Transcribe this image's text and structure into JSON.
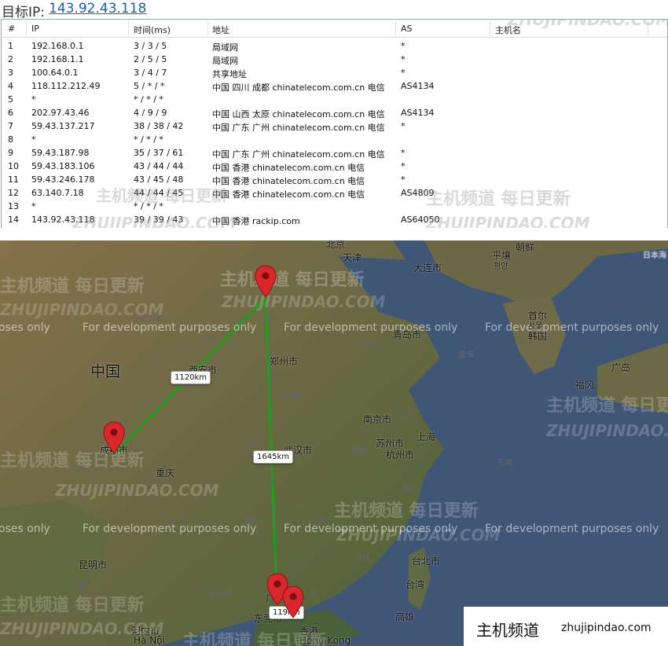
{
  "header": {
    "label": "目标IP:",
    "ip": "143.92.43.118"
  },
  "table": {
    "columns": [
      "#",
      "IP",
      "时间(ms)",
      "地址",
      "AS",
      "主机名"
    ],
    "rows": [
      {
        "n": "1",
        "ip": "192.168.0.1",
        "time": "3 / 3 / 5",
        "addr": "局域网",
        "as": "*"
      },
      {
        "n": "2",
        "ip": "192.168.1.1",
        "time": "2 / 5 / 5",
        "addr": "局域网",
        "as": "*"
      },
      {
        "n": "3",
        "ip": "100.64.0.1",
        "time": "3 / 4 / 7",
        "addr": "共享地址",
        "as": "*"
      },
      {
        "n": "4",
        "ip": "118.112.212.49",
        "time": "5 / * / *",
        "addr": "中国 四川 成都 chinatelecom.com.cn 电信",
        "as": "AS4134"
      },
      {
        "n": "5",
        "ip": "*",
        "time": "* / * / *",
        "addr": "",
        "as": ""
      },
      {
        "n": "6",
        "ip": "202.97.43.46",
        "time": "4 / 9 / 9",
        "addr": "中国 山西 太原 chinatelecom.com.cn 电信",
        "as": "AS4134"
      },
      {
        "n": "7",
        "ip": "59.43.137.217",
        "time": "38 / 38 / 42",
        "addr": "中国 广东 广州 chinatelecom.com.cn 电信",
        "as": "*"
      },
      {
        "n": "8",
        "ip": "*",
        "time": "* / * / *",
        "addr": "",
        "as": ""
      },
      {
        "n": "9",
        "ip": "59.43.187.98",
        "time": "35 / 37 / 61",
        "addr": "中国 广东 广州 chinatelecom.com.cn 电信",
        "as": "*"
      },
      {
        "n": "10",
        "ip": "59.43.183.106",
        "time": "43 / 44 / 44",
        "addr": "中国 香港 chinatelecom.com.cn 电信",
        "as": "*"
      },
      {
        "n": "11",
        "ip": "59.43.246.178",
        "time": "43 / 45 / 48",
        "addr": "中国 香港 chinatelecom.com.cn 电信",
        "as": "*"
      },
      {
        "n": "12",
        "ip": "63.140.7.18",
        "time": "44 / 44 / 45",
        "addr": "中国 香港 chinatelecom.com.cn 电信",
        "as": "AS4809"
      },
      {
        "n": "13",
        "ip": "*",
        "time": "* / * / *",
        "addr": "",
        "as": ""
      },
      {
        "n": "14",
        "ip": "143.92.43.118",
        "time": "39 / 39 / 43",
        "addr": "中国 香港 rackip.com",
        "as": "AS64050"
      }
    ]
  },
  "map": {
    "dev_text": "For development purposes only",
    "dev_text_left": "oses only",
    "cities": {
      "beijing": "北京",
      "tianjin": "天津",
      "dalian": "大连市",
      "pingrang": "平壤",
      "pingrang_ko": "평양",
      "chaoxian": "朝鲜",
      "shouer": "首尔",
      "shouer_ko": "서울",
      "hanguo": "韩国",
      "qingdao": "青岛市",
      "zhongguo": "中国",
      "xian": "西安市",
      "zhengzhou": "郑州市",
      "nanjing": "南京市",
      "shanghai": "上海",
      "suzhou": "苏州市",
      "hangzhou": "杭州市",
      "wuhan": "武汉市",
      "chengdu": "成都市",
      "chongqing": "重庆",
      "kunming": "昆明市",
      "taibei": "台北市",
      "taiwan": "台湾",
      "gaoxiong": "高雄",
      "dongguan": "东莞市",
      "xianggang": "香港",
      "hongkong": "Hong Kong",
      "hanei": "河内市",
      "hanoi": "Hà Nội",
      "guangdao": "广岛",
      "fugang": "福冈",
      "riben": "日本海",
      "guangzhou": "广"
    },
    "provinces": {
      "ningxia": "宁夏 回族",
      "shanxi_s": "陕西",
      "shanxi": "山西",
      "shandong": "山东",
      "henan": "河南",
      "hubei": "湖北",
      "jiangsu": "江苏",
      "anhui": "安徽",
      "zhejiang": "浙江",
      "jiangxi": "江西",
      "hunan": "湖南",
      "guizhou": "贵州",
      "sichuan": "四川",
      "yunnan": "云南",
      "guangxi": "广西壮族",
      "fujian": "福建",
      "donghai": "东海",
      "huanghai": "黄海",
      "guangdong": "东"
    },
    "distances": {
      "leg1": "1120km",
      "leg2": "1645km",
      "leg3": "119km"
    }
  },
  "watermark": {
    "cn": "主机频道 每日更新",
    "en": "ZHUJIPINDAO.COM"
  },
  "logo": {
    "cn": "主机频道",
    "en": "zhujipindao.com"
  },
  "colors": {
    "route": "#1e9e1e",
    "pin": "#d9272b",
    "link": "#1a5fb4"
  }
}
